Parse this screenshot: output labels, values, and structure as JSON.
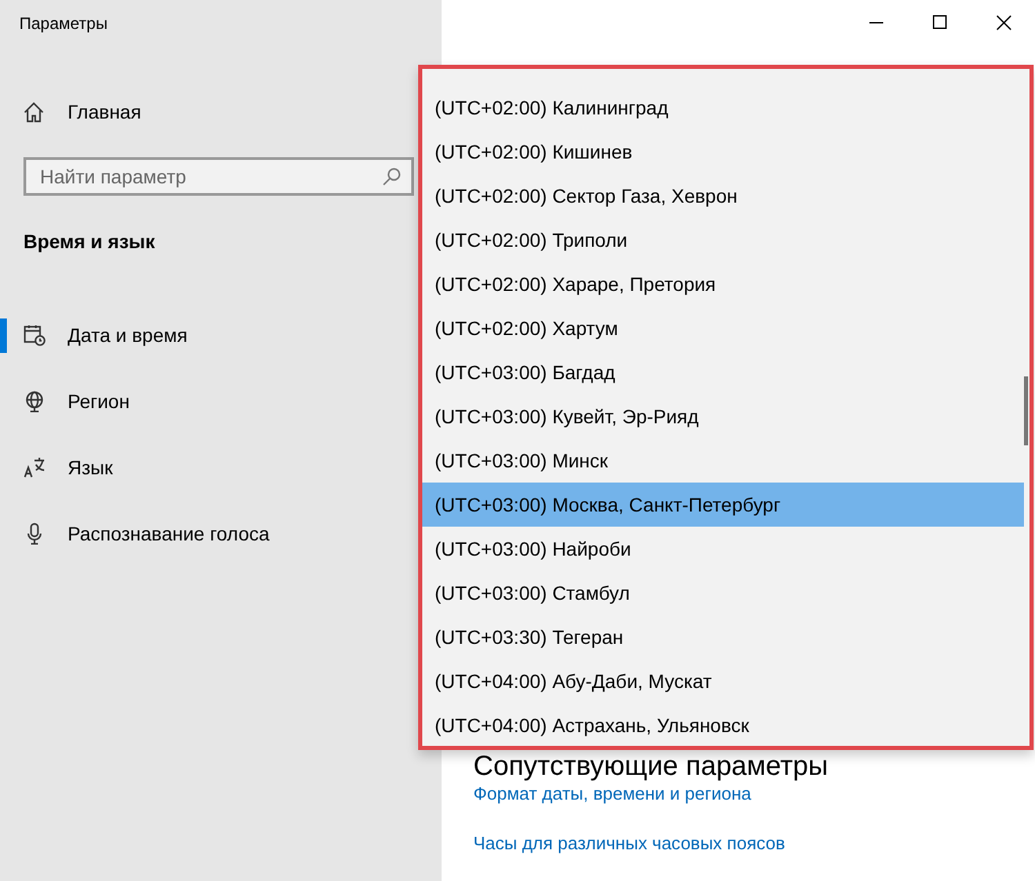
{
  "window": {
    "title": "Параметры",
    "controls": [
      {
        "kind": "minimize"
      },
      {
        "kind": "maximize"
      },
      {
        "kind": "close"
      }
    ]
  },
  "sidebar": {
    "home": "Главная",
    "search": {
      "placeholder": "Найти параметр"
    },
    "section": "Время и язык",
    "items": [
      {
        "label": "Дата и время",
        "kind": "calendar",
        "selected": true
      },
      {
        "label": "Регион",
        "kind": "globe",
        "selected": false
      },
      {
        "label": "Язык",
        "kind": "language",
        "selected": false
      },
      {
        "label": "Распознавание голоса",
        "kind": "microphone",
        "selected": false
      }
    ]
  },
  "content": {
    "heading": "Сопутствующие параметры",
    "links": [
      "Формат даты, времени и региона",
      "Часы для различных часовых поясов"
    ]
  },
  "timezone_dropdown": {
    "items": [
      {
        "label": "(UTC+02:00) Калининград",
        "selected": false
      },
      {
        "label": "(UTC+02:00) Кишинев",
        "selected": false
      },
      {
        "label": "(UTC+02:00) Сектор Газа, Хеврон",
        "selected": false
      },
      {
        "label": "(UTC+02:00) Триполи",
        "selected": false
      },
      {
        "label": "(UTC+02:00) Хараре, Претория",
        "selected": false
      },
      {
        "label": "(UTC+02:00) Хартум",
        "selected": false
      },
      {
        "label": "(UTC+03:00) Багдад",
        "selected": false
      },
      {
        "label": "(UTC+03:00) Кувейт, Эр-Рияд",
        "selected": false
      },
      {
        "label": "(UTC+03:00) Минск",
        "selected": false
      },
      {
        "label": "(UTC+03:00) Москва, Санкт-Петербург",
        "selected": true
      },
      {
        "label": "(UTC+03:00) Найроби",
        "selected": false
      },
      {
        "label": "(UTC+03:00) Стамбул",
        "selected": false
      },
      {
        "label": "(UTC+03:30) Тегеран",
        "selected": false
      },
      {
        "label": "(UTC+04:00) Абу-Даби, Мускат",
        "selected": false
      },
      {
        "label": "(UTC+04:00) Астрахань, Ульяновск",
        "selected": false
      }
    ]
  }
}
